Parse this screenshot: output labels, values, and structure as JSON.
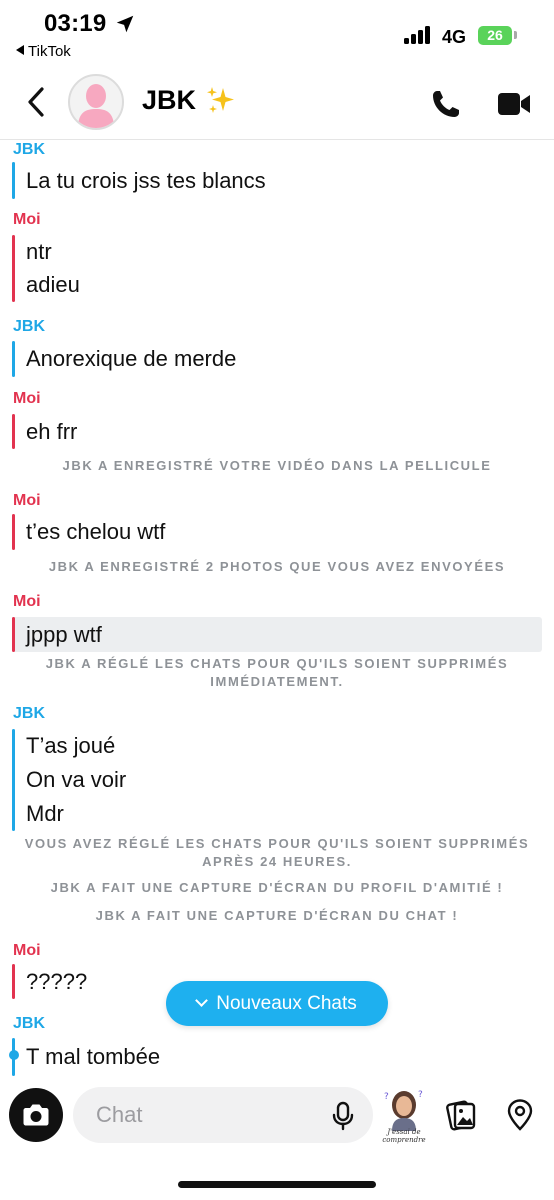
{
  "status_bar": {
    "time": "03:19",
    "back_app": "TikTok",
    "network": "4G",
    "battery": "26"
  },
  "header": {
    "contact_name": "JBK",
    "contact_emoji": "sparkles-icon"
  },
  "conversation": [
    {
      "kind": "sender",
      "who": "JBK"
    },
    {
      "kind": "message",
      "who": "JBK",
      "lines": [
        "La tu crois jss tes blancs"
      ]
    },
    {
      "kind": "sender",
      "who": "Moi"
    },
    {
      "kind": "message",
      "who": "Moi",
      "lines": [
        "ntr",
        "adieu"
      ]
    },
    {
      "kind": "sender",
      "who": "JBK"
    },
    {
      "kind": "message",
      "who": "JBK",
      "lines": [
        "Anorexique de merde"
      ]
    },
    {
      "kind": "sender",
      "who": "Moi"
    },
    {
      "kind": "message",
      "who": "Moi",
      "lines": [
        "eh frr"
      ]
    },
    {
      "kind": "system",
      "lines": [
        "JBK A ENREGISTRÉ VOTRE VIDÉO DANS LA PELLICULE"
      ]
    },
    {
      "kind": "sender",
      "who": "Moi"
    },
    {
      "kind": "message",
      "who": "Moi",
      "lines": [
        "t’es chelou wtf"
      ]
    },
    {
      "kind": "system",
      "lines": [
        "JBK A ENREGISTRÉ 2 PHOTOS QUE VOUS AVEZ ENVOYÉES"
      ]
    },
    {
      "kind": "sender",
      "who": "Moi"
    },
    {
      "kind": "message",
      "who": "Moi",
      "lines": [
        "jppp wtf"
      ],
      "highlighted": true
    },
    {
      "kind": "system",
      "lines": [
        "JBK A RÉGLÉ LES CHATS POUR QU'ILS SOIENT SUPPRIMÉS",
        "IMMÉDIATEMENT."
      ]
    },
    {
      "kind": "sender",
      "who": "JBK"
    },
    {
      "kind": "message",
      "who": "JBK",
      "lines": [
        "T’as joué",
        "On va voir",
        "Mdr"
      ]
    },
    {
      "kind": "system",
      "lines": [
        "VOUS AVEZ RÉGLÉ LES CHATS POUR QU'ILS SOIENT SUPPRIMÉS",
        "APRÈS 24 HEURES."
      ]
    },
    {
      "kind": "system",
      "lines": [
        "JBK A FAIT UNE CAPTURE D'ÉCRAN DU PROFIL D'AMITIÉ !"
      ]
    },
    {
      "kind": "system",
      "lines": [
        "JBK A FAIT UNE CAPTURE D'ÉCRAN DU CHAT !"
      ]
    },
    {
      "kind": "sender",
      "who": "Moi"
    },
    {
      "kind": "message",
      "who": "Moi",
      "lines": [
        "?????"
      ]
    },
    {
      "kind": "sender",
      "who": "JBK"
    },
    {
      "kind": "message",
      "who": "JBK",
      "lines": [
        "T mal tombée"
      ],
      "typing_dot": true
    }
  ],
  "new_chats_button": "Nouveaux Chats",
  "composer": {
    "placeholder": "Chat",
    "bitmoji_caption": "J'essai de comprendre"
  },
  "colors": {
    "jbk": "#1ea7e6",
    "moi": "#e2334f",
    "accent": "#1eb0ef",
    "system_text": "#8e9297"
  }
}
